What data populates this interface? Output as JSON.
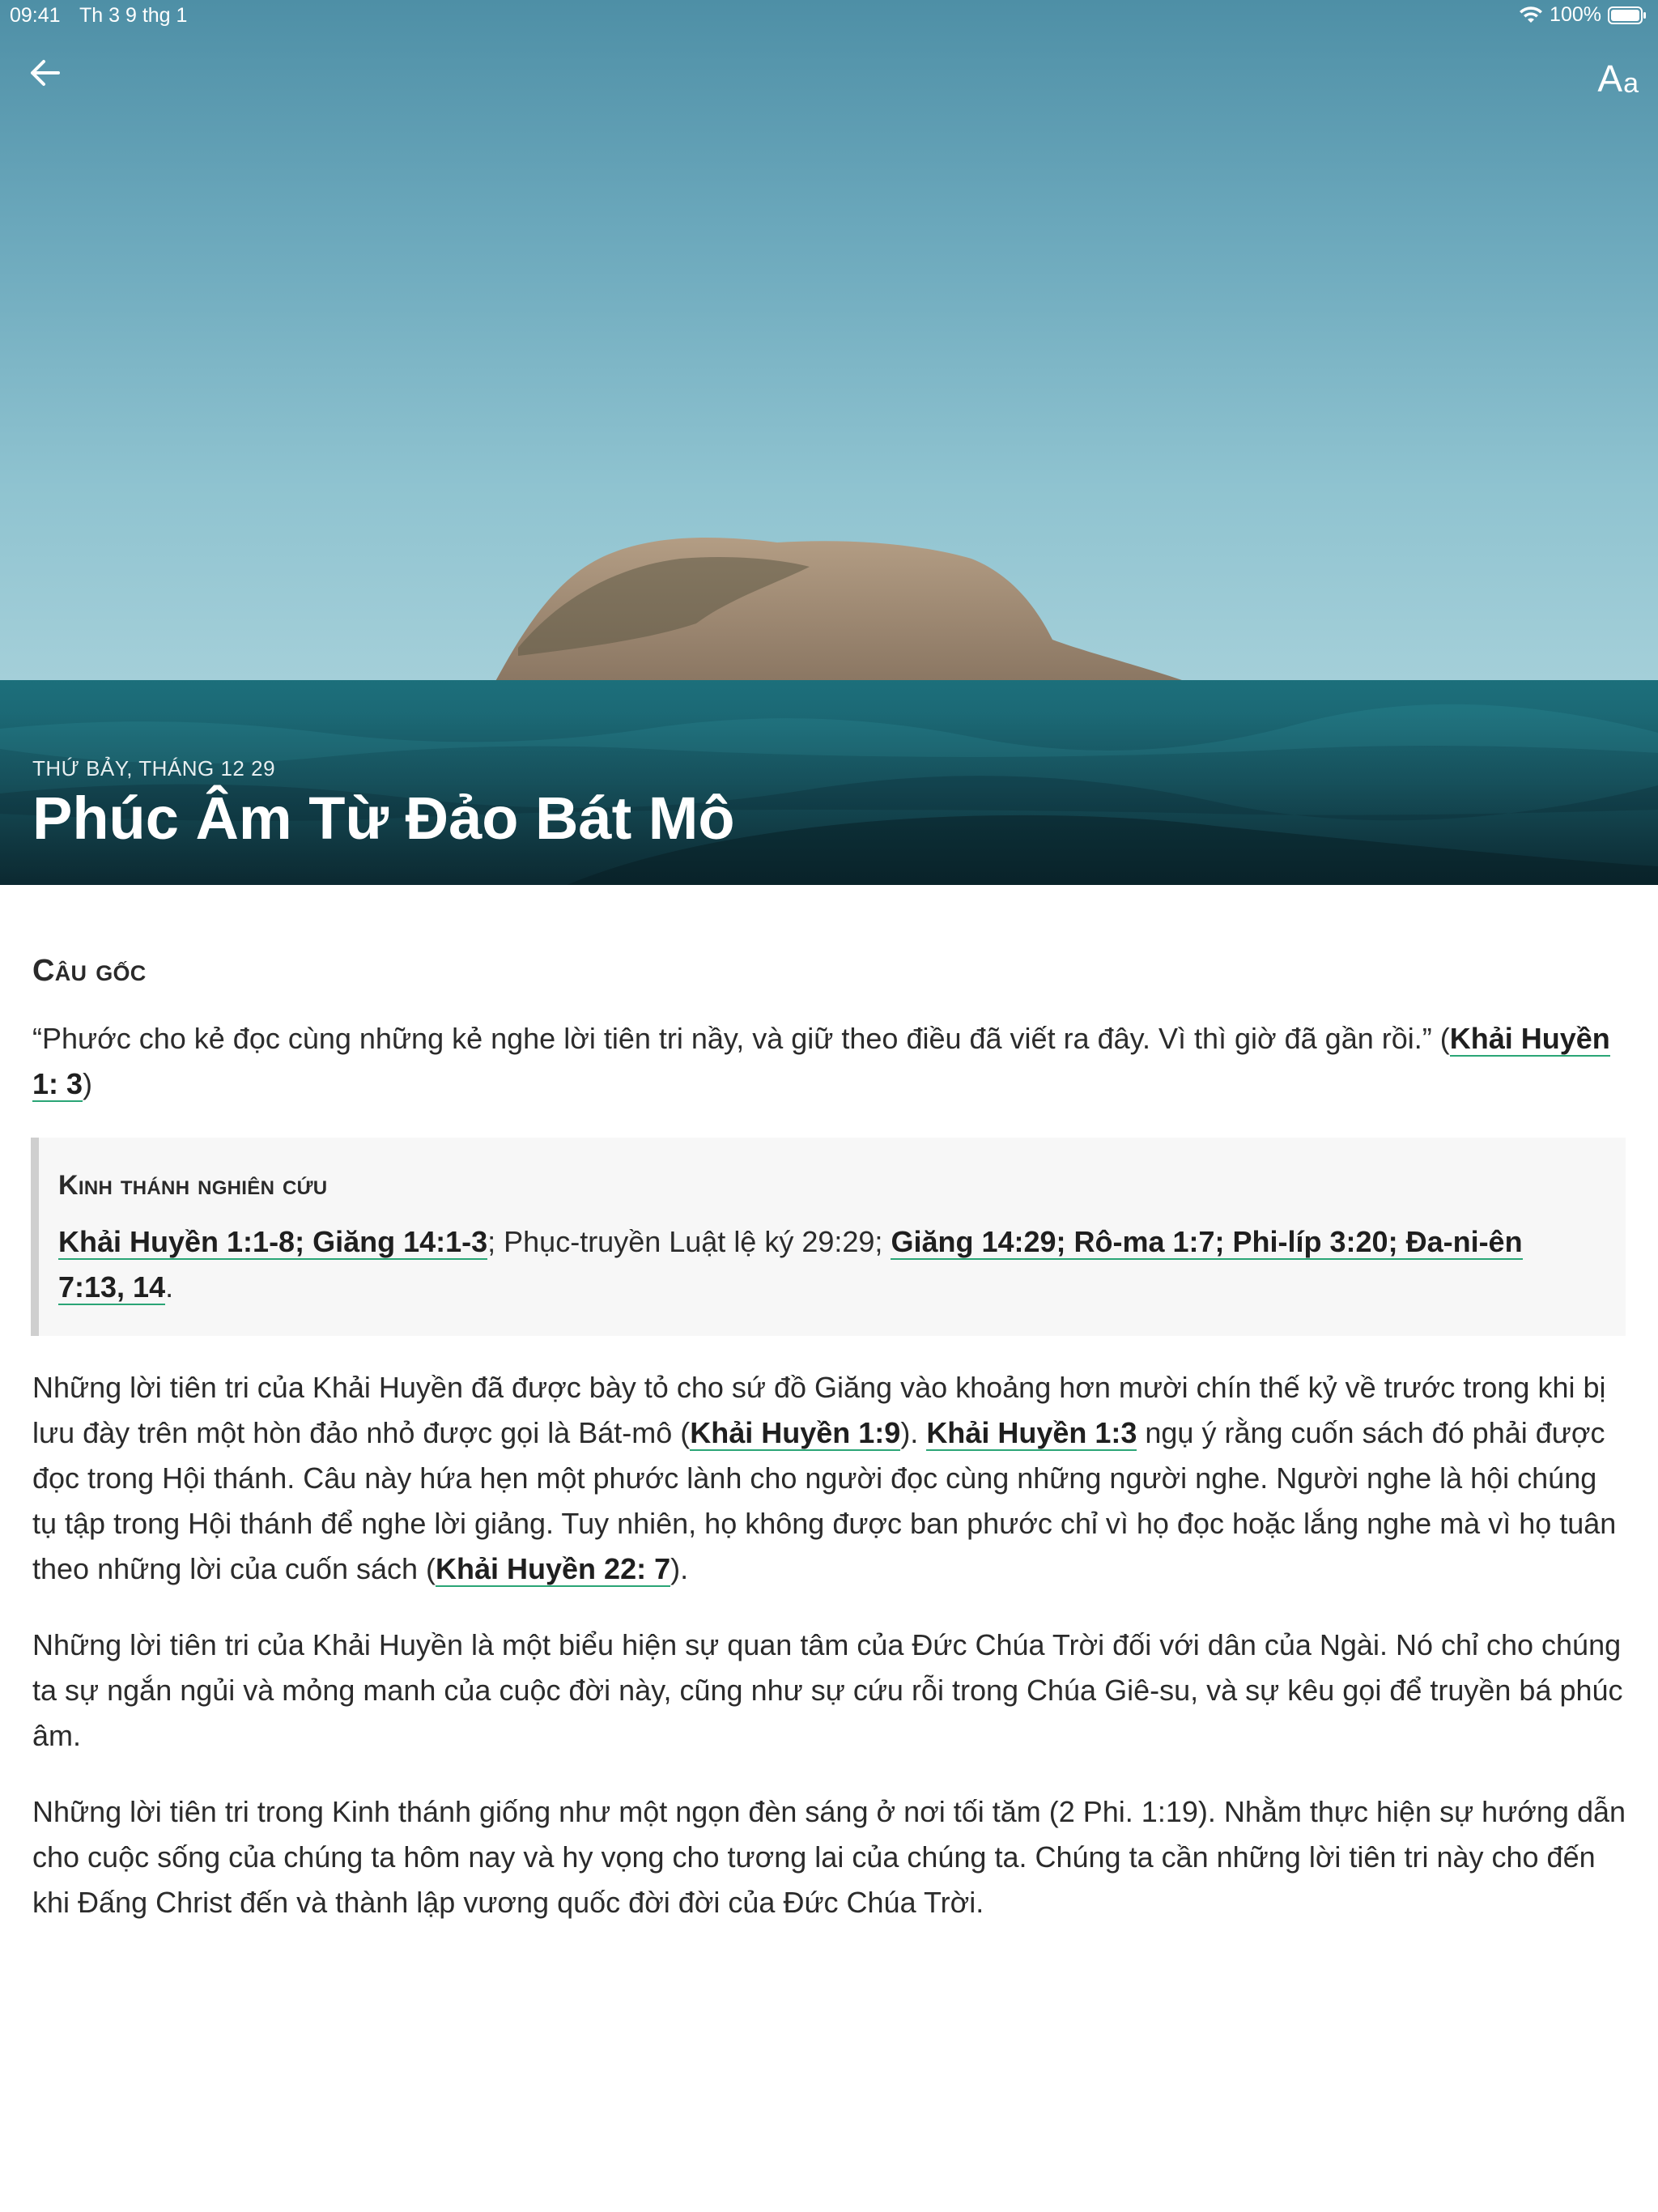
{
  "status_bar": {
    "time": "09:41",
    "date": "Th 3 9 thg 1",
    "battery": "100%",
    "wifi_icon": "wifi-icon",
    "battery_icon": "battery-icon"
  },
  "toolbar": {
    "back_icon": "arrow-left-icon",
    "font_label_big": "A",
    "font_label_small": "a"
  },
  "hero": {
    "date": "THỨ BẢY, THÁNG 12 29",
    "title": "Phúc Âm Từ Đảo Bát Mô"
  },
  "memory_verse": {
    "heading": "Câu gốc",
    "text": "“Phước cho kẻ đọc cùng những kẻ nghe lời tiên tri nầy, và giữ theo điều đã viết ra đây. Vì thì giờ đã gần rồi.” (",
    "ref": "Khải Huyền 1: 3",
    "suffix": ")"
  },
  "study": {
    "heading": "Kinh thánh nghiên cứu",
    "ref1": "Khải Huyền 1:1-8; Giăng 14:1-3",
    "plain": "; Phục-truyền Luật lệ ký 29:29; ",
    "ref2": "Giăng 14:29; Rô-ma 1:7; Phi-líp 3:20; Đa-ni-ên 7:13, 14",
    "suffix": "."
  },
  "paragraphs": {
    "p1": {
      "a": "Những lời tiên tri của Khải Huyền đã được bày tỏ cho sứ đồ Giăng vào khoảng hơn mười chín thế kỷ về trước trong khi bị lưu đày trên một hòn đảo nhỏ được gọi là Bát-mô (",
      "ref1": "Khải Huyền 1:9",
      "b": "). ",
      "ref2": "Khải Huyền 1:3",
      "c": " ngụ ý rằng cuốn sách đó phải được đọc trong Hội thánh. Câu này hứa hẹn một phước lành cho người đọc cùng những người nghe. Người nghe là hội chúng tụ tập trong Hội thánh để nghe lời giảng. Tuy nhiên, họ không được ban phước chỉ vì họ đọc hoặc lắng nghe mà vì họ tuân theo những lời của cuốn sách (",
      "ref3": "Khải Huyền 22: 7",
      "d": ")."
    },
    "p2": "Những lời tiên tri của Khải Huyền là một biểu hiện sự quan tâm của Đức Chúa Trời đối với dân của Ngài. Nó chỉ cho chúng ta sự ngắn ngủi và mỏng manh của cuộc đời này, cũng như sự cứu rỗi trong Chúa Giê-su, và sự kêu gọi để truyền bá phúc âm.",
    "p3": "Những lời tiên tri trong Kinh thánh giống như một ngọn đèn sáng ở nơi tối tăm (2 Phi. 1:19). Nhằm thực hiện sự hướng dẫn cho cuộc sống của chúng ta hôm nay và hy vọng cho tương lai của chúng ta. Chúng ta cần những lời tiên tri này cho đến khi Đấng Christ đến và thành lập vương quốc đời đời của Đức Chúa Trời."
  },
  "colors": {
    "link_underline": "#2aa576",
    "sea": "#1f6e78",
    "sky": "#8fc3d0"
  }
}
